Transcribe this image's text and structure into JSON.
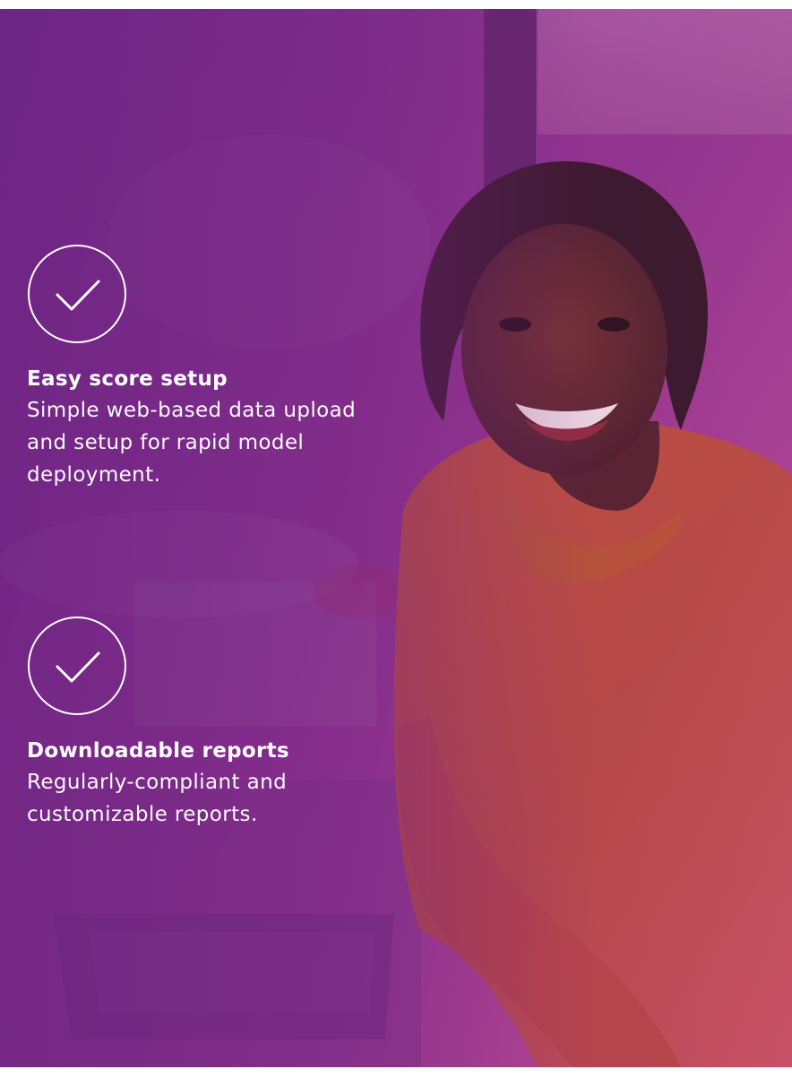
{
  "features": [
    {
      "icon": "check-circle-icon",
      "title": "Easy score setup",
      "description": "Simple web-based data upload and setup for rapid model deployment."
    },
    {
      "icon": "check-circle-icon",
      "title": "Downloadable reports",
      "description": "Regularly-compliant and customizable reports."
    }
  ],
  "colors": {
    "overlay_primary": "#7d2887",
    "overlay_secondary": "#c55a96",
    "text": "#ffffff"
  },
  "image": {
    "subject": "smiling-woman-in-orange-sweater"
  }
}
